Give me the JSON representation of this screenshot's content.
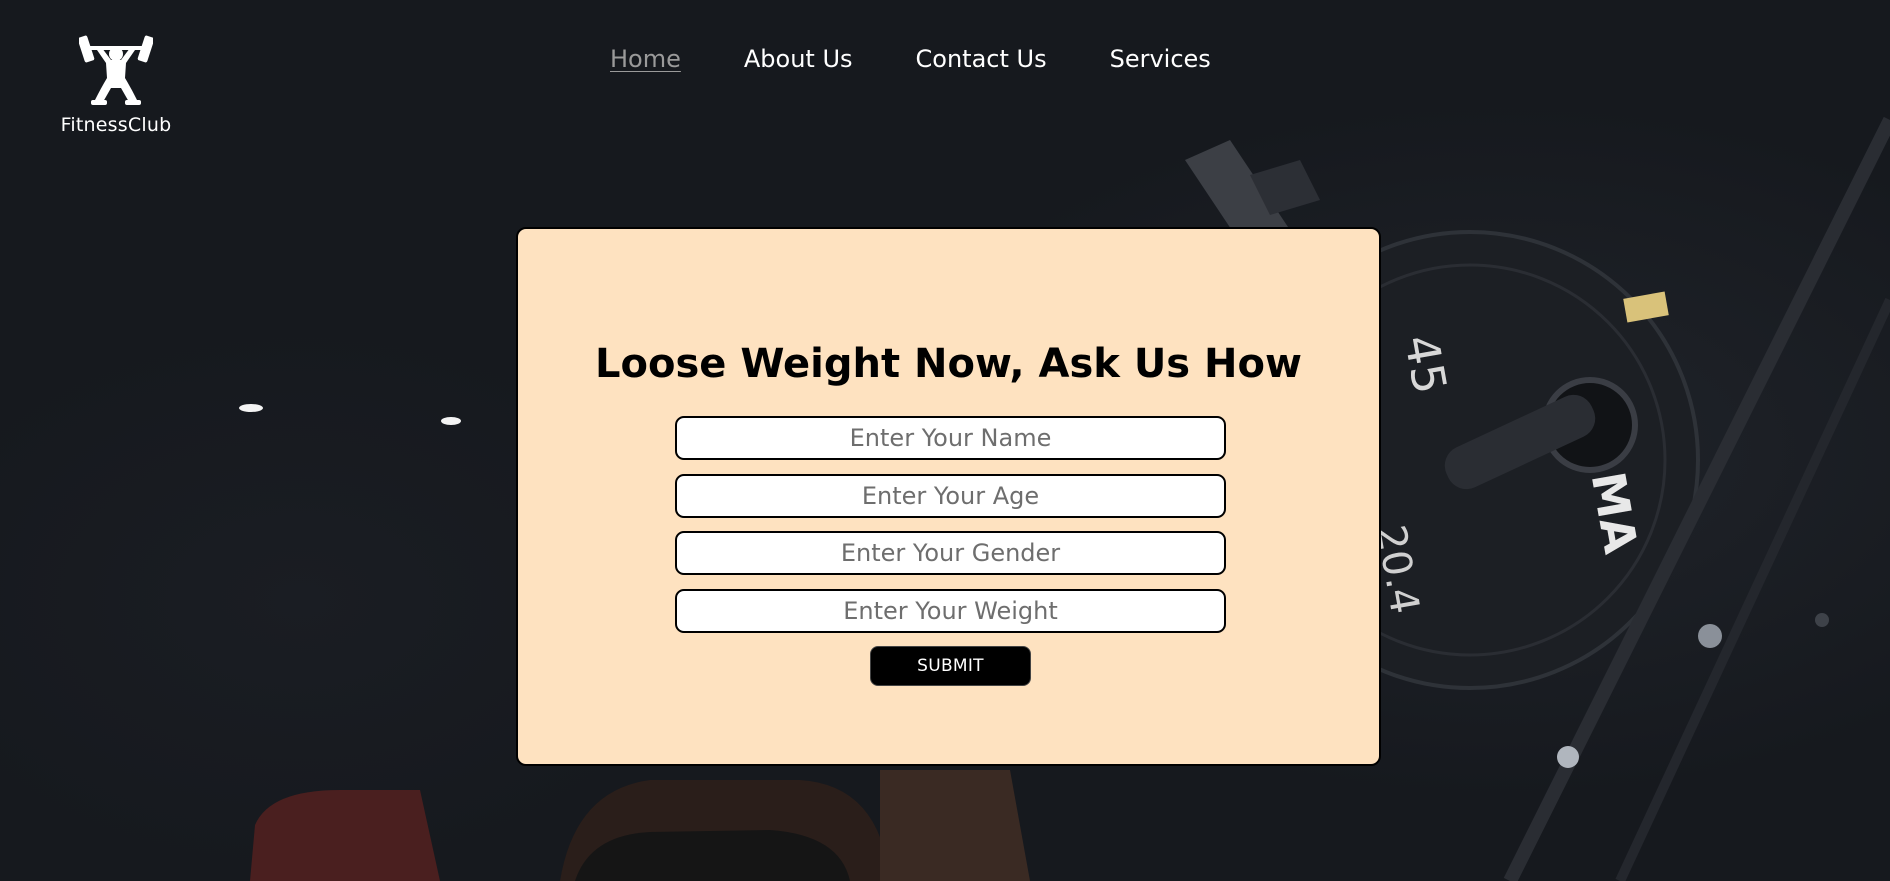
{
  "brand": {
    "name": "FitnessClub",
    "icon": "weightlifter-icon"
  },
  "nav": {
    "items": [
      {
        "label": "Home",
        "active": true
      },
      {
        "label": "About Us",
        "active": false
      },
      {
        "label": "Contact Us",
        "active": false
      },
      {
        "label": "Services",
        "active": false
      }
    ]
  },
  "form": {
    "title": "Loose Weight Now, Ask Us How",
    "fields": [
      {
        "placeholder": "Enter Your Name",
        "value": ""
      },
      {
        "placeholder": "Enter Your Age",
        "value": ""
      },
      {
        "placeholder": "Enter Your Gender",
        "value": ""
      },
      {
        "placeholder": "Enter Your Weight",
        "value": ""
      }
    ],
    "submit_label": "SUBMIT"
  },
  "background": {
    "plate_numbers": [
      "45",
      "20.4",
      "MA"
    ]
  },
  "colors": {
    "page_bg": "#16191e",
    "card_bg": "#fee2c0",
    "nav_text": "#ffffff",
    "nav_active": "#9a9a9a",
    "button_bg": "#000000"
  }
}
